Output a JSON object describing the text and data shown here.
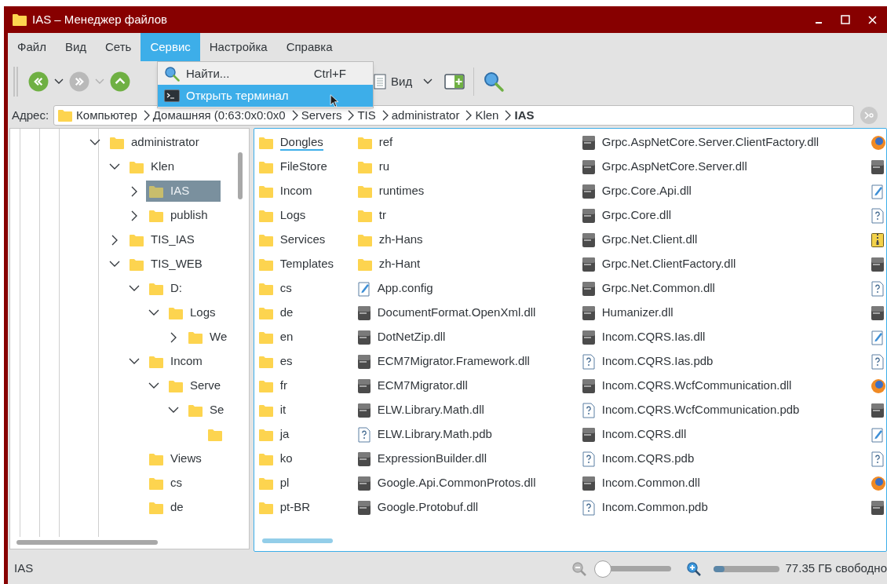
{
  "window": {
    "title": "IAS – Менеджер файлов"
  },
  "menu_bar": [
    {
      "label": "Файл",
      "selected": false
    },
    {
      "label": "Вид",
      "selected": false
    },
    {
      "label": "Сеть",
      "selected": false
    },
    {
      "label": "Сервис",
      "selected": true
    },
    {
      "label": "Настройка",
      "selected": false
    },
    {
      "label": "Справка",
      "selected": false
    }
  ],
  "open_menu": [
    {
      "kind": "search",
      "label": "Найти...",
      "shortcut": "Ctrl+F",
      "selected": false
    },
    {
      "kind": "terminal",
      "label": "Открыть терминал",
      "selected": true
    }
  ],
  "toolbar": {
    "nav": [
      {
        "kind": "back",
        "disabled": false
      },
      {
        "kind": "forward",
        "disabled": true
      },
      {
        "kind": "up",
        "disabled": false
      }
    ],
    "view_button": "Вид"
  },
  "address": {
    "label": "Адрес:",
    "crumbs": [
      {
        "label": "Компьютер",
        "current": false
      },
      {
        "label": "Домашняя (0:63:0x0:0x0",
        "current": false
      },
      {
        "label": "Servers",
        "current": false
      },
      {
        "label": "TIS",
        "current": false
      },
      {
        "label": "administrator",
        "current": false
      },
      {
        "label": "Klen",
        "current": false
      },
      {
        "label": "IAS",
        "current": true
      }
    ]
  },
  "tree": [
    {
      "label": "administrator",
      "expanded": true,
      "selected": false,
      "children": [
        {
          "label": "Klen",
          "expanded": true,
          "selected": false,
          "children": [
            {
              "label": "IAS",
              "expanded": false,
              "selected": true
            },
            {
              "label": "publish",
              "expanded": false,
              "selected": false
            }
          ]
        },
        {
          "label": "TIS_IAS",
          "expanded": false,
          "selected": false
        },
        {
          "label": "TIS_WEB",
          "expanded": true,
          "selected": false,
          "children": [
            {
              "label": "D:",
              "expanded": true,
              "selected": false,
              "children": [
                {
                  "label": "Logs",
                  "expanded": true,
                  "selected": false,
                  "children": [
                    {
                      "label": "We",
                      "expanded": false,
                      "selected": false
                    }
                  ]
                }
              ]
            },
            {
              "label": "Incom",
              "expanded": true,
              "selected": false,
              "children": [
                {
                  "label": "Serve",
                  "expanded": true,
                  "selected": false,
                  "children": [
                    {
                      "label": "Se",
                      "expanded": true,
                      "selected": false,
                      "children": [
                        {
                          "selected": false
                        }
                      ]
                    }
                  ]
                }
              ]
            },
            {
              "label": "Views",
              "selected": false
            },
            {
              "label": "cs",
              "selected": false
            },
            {
              "label": "de",
              "selected": false
            }
          ]
        }
      ]
    }
  ],
  "files": [
    [
      {
        "name": "Dongles",
        "kind": "folder",
        "current": true
      },
      {
        "name": "FileStore",
        "kind": "folder",
        "current": false
      },
      {
        "name": "Incom",
        "kind": "folder",
        "current": false
      },
      {
        "name": "Logs",
        "kind": "folder",
        "current": false
      },
      {
        "name": "Services",
        "kind": "folder",
        "current": false
      },
      {
        "name": "Templates",
        "kind": "folder",
        "current": false
      },
      {
        "name": "cs",
        "kind": "folder",
        "current": false
      },
      {
        "name": "de",
        "kind": "folder",
        "current": false
      },
      {
        "name": "en",
        "kind": "folder",
        "current": false
      },
      {
        "name": "es",
        "kind": "folder",
        "current": false
      },
      {
        "name": "fr",
        "kind": "folder",
        "current": false
      },
      {
        "name": "it",
        "kind": "folder",
        "current": false
      },
      {
        "name": "ja",
        "kind": "folder",
        "current": false
      },
      {
        "name": "ko",
        "kind": "folder",
        "current": false
      },
      {
        "name": "pl",
        "kind": "folder",
        "current": false
      },
      {
        "name": "pt-BR",
        "kind": "folder",
        "current": false
      }
    ],
    [
      {
        "name": "ref",
        "kind": "folder",
        "current": false
      },
      {
        "name": "ru",
        "kind": "folder",
        "current": false
      },
      {
        "name": "runtimes",
        "kind": "folder",
        "current": false
      },
      {
        "name": "tr",
        "kind": "folder",
        "current": false
      },
      {
        "name": "zh-Hans",
        "kind": "folder",
        "current": false
      },
      {
        "name": "zh-Hant",
        "kind": "folder",
        "current": false
      },
      {
        "name": "App.config",
        "kind": "config",
        "current": false
      },
      {
        "name": "DocumentFormat.OpenXml.dll",
        "kind": "dll",
        "current": false
      },
      {
        "name": "DotNetZip.dll",
        "kind": "dll",
        "current": false
      },
      {
        "name": "ECM7Migrator.Framework.dll",
        "kind": "dll",
        "current": false
      },
      {
        "name": "ECM7Migrator.dll",
        "kind": "dll",
        "current": false
      },
      {
        "name": "ELW.Library.Math.dll",
        "kind": "dll",
        "current": false
      },
      {
        "name": "ELW.Library.Math.pdb",
        "kind": "pdb",
        "current": false
      },
      {
        "name": "ExpressionBuilder.dll",
        "kind": "dll",
        "current": false
      },
      {
        "name": "Google.Api.CommonProtos.dll",
        "kind": "dll",
        "current": false
      },
      {
        "name": "Google.Protobuf.dll",
        "kind": "dll",
        "current": false
      }
    ],
    [
      {
        "name": "Grpc.AspNetCore.Server.ClientFactory.dll",
        "kind": "dll",
        "current": false
      },
      {
        "name": "Grpc.AspNetCore.Server.dll",
        "kind": "dll",
        "current": false
      },
      {
        "name": "Grpc.Core.Api.dll",
        "kind": "dll",
        "current": false
      },
      {
        "name": "Grpc.Core.dll",
        "kind": "dll",
        "current": false
      },
      {
        "name": "Grpc.Net.Client.dll",
        "kind": "dll",
        "current": false
      },
      {
        "name": "Grpc.Net.ClientFactory.dll",
        "kind": "dll",
        "current": false
      },
      {
        "name": "Grpc.Net.Common.dll",
        "kind": "dll",
        "current": false
      },
      {
        "name": "Humanizer.dll",
        "kind": "dll",
        "current": false
      },
      {
        "name": "Incom.CQRS.Ias.dll",
        "kind": "dll",
        "current": false
      },
      {
        "name": "Incom.CQRS.Ias.pdb",
        "kind": "pdb",
        "current": false
      },
      {
        "name": "Incom.CQRS.WcfCommunication.dll",
        "kind": "dll",
        "current": false
      },
      {
        "name": "Incom.CQRS.WcfCommunication.pdb",
        "kind": "pdb",
        "current": false
      },
      {
        "name": "Incom.CQRS.dll",
        "kind": "dll",
        "current": false
      },
      {
        "name": "Incom.CQRS.pdb",
        "kind": "pdb",
        "current": false
      },
      {
        "name": "Incom.Common.dll",
        "kind": "dll",
        "current": false
      },
      {
        "name": "Incom.Common.pdb",
        "kind": "pdb",
        "current": false
      }
    ],
    [
      {
        "kind": "web"
      },
      {
        "kind": "dll"
      },
      {
        "kind": "config"
      },
      {
        "kind": "pdb"
      },
      {
        "kind": "archive"
      },
      {
        "kind": "dll"
      },
      {
        "kind": "pdb"
      },
      {
        "kind": "dll"
      },
      {
        "kind": "config"
      },
      {
        "kind": "pdb"
      },
      {
        "kind": "web"
      },
      {
        "kind": "dll"
      },
      {
        "kind": "config"
      },
      {
        "kind": "pdb"
      },
      {
        "kind": "web"
      },
      {
        "kind": "dll"
      }
    ]
  ],
  "status_bar": {
    "text": "IAS",
    "zoom": {
      "level": 0
    },
    "disk": {
      "level": 0.17,
      "text": "77.35 ГБ свободно"
    }
  }
}
